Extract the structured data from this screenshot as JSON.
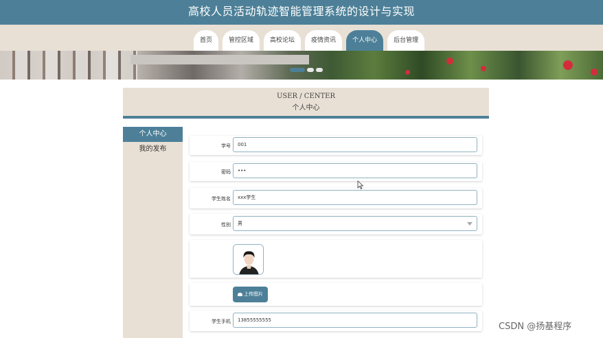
{
  "header": {
    "title": "高校人员活动轨迹智能管理系统的设计与实现"
  },
  "nav": {
    "items": [
      "首页",
      "管控区域",
      "高校论坛",
      "疫情资讯",
      "个人中心",
      "后台管理"
    ],
    "active_index": 4
  },
  "center": {
    "title_en": "USER / CENTER",
    "title_cn": "个人中心"
  },
  "sidebar": {
    "items": [
      "个人中心",
      "我的发布"
    ]
  },
  "form": {
    "student_id": {
      "label": "学号",
      "value": "001"
    },
    "password": {
      "label": "密码",
      "value": "•••"
    },
    "student_name": {
      "label": "学生姓名",
      "value": "xxx学生"
    },
    "gender": {
      "label": "性别",
      "value": "男"
    },
    "upload": {
      "label": "上传图片",
      "icon": "cloud-upload-icon"
    },
    "phone": {
      "label": "学生手机",
      "value": "13855555555"
    }
  },
  "colors": {
    "accent": "#4d8098",
    "beige": "#e9e0d5"
  },
  "watermark": "CSDN @扬基程序"
}
